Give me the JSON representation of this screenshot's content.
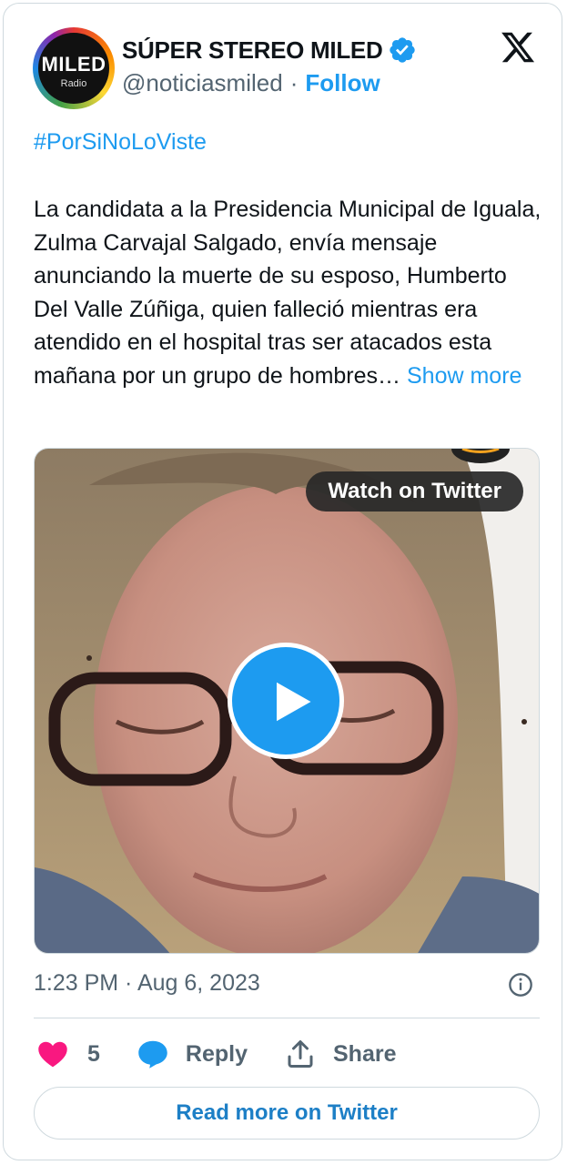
{
  "account": {
    "display_name": "SÚPER STEREO MILED",
    "handle": "@noticiasmiled",
    "separator": "·",
    "follow_label": "Follow",
    "avatar_logo_text": "MILED",
    "avatar_sub_text": "Radio",
    "verified": true
  },
  "tweet": {
    "hashtag": "#PorSiNoLoViste",
    "body": "La candidata a la Presidencia Municipal de Iguala, Zulma Carvajal Salgado, envía mensaje anunciando la muerte de su esposo, Humberto Del Valle Zúñiga, quien falleció mientras era atendido en el hospital tras ser atacados esta mañana por un grupo de hombres…",
    "show_more_label": "Show more",
    "timestamp": "1:23 PM · Aug 6, 2023"
  },
  "media": {
    "type": "video",
    "watch_label": "Watch on Twitter"
  },
  "actions": {
    "like_count": "5",
    "reply_label": "Reply",
    "share_label": "Share"
  },
  "read_more_label": "Read more on Twitter",
  "colors": {
    "accent": "#1d9bf0",
    "like": "#f91880",
    "text_secondary": "#536471",
    "border": "#cfd9de"
  },
  "icons": {
    "brand": "x-logo-icon",
    "verified": "verified-badge-icon",
    "play": "play-icon",
    "info": "info-icon",
    "like": "heart-icon",
    "reply": "speech-bubble-icon",
    "share": "share-upload-icon"
  }
}
